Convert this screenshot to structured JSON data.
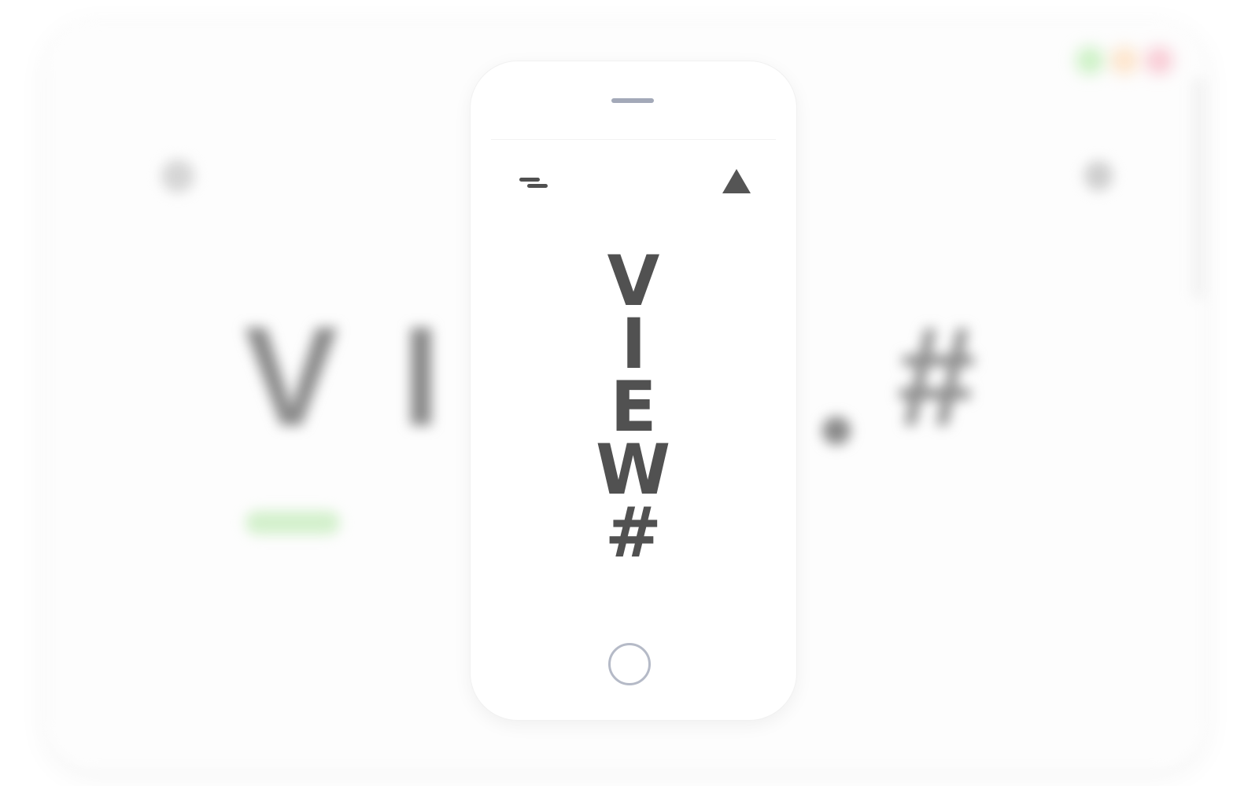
{
  "background": {
    "headline_letters": [
      "V",
      "I",
      "#"
    ],
    "dot_colors": [
      "#c8f0c0",
      "#fde2c7",
      "#f8c7d1"
    ],
    "pill_color": "#d3f0cc"
  },
  "phone": {
    "title_chars": [
      "V",
      "I",
      "E",
      "W",
      "#"
    ],
    "text_color": "#515151",
    "menu_icon": "menu-icon",
    "up_icon": "triangle-up-icon",
    "home_icon": "home-button-circle"
  }
}
